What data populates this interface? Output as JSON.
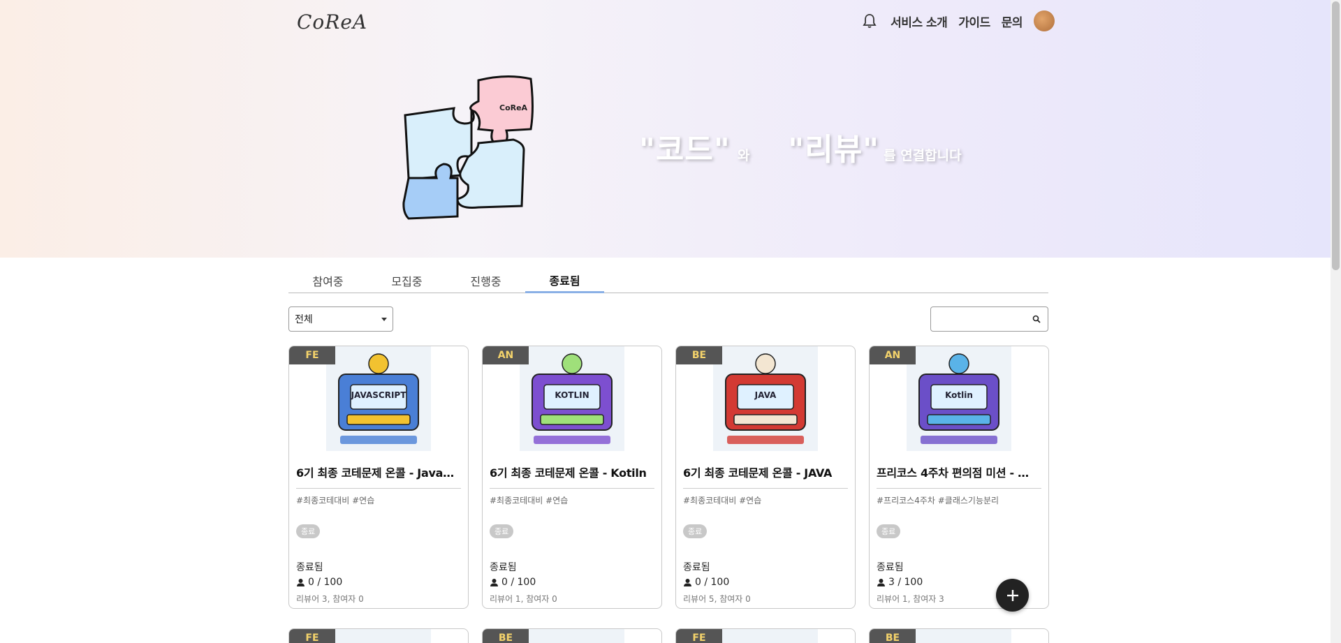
{
  "header": {
    "logo": "CoReA",
    "nav": [
      "서비스 소개",
      "가이드",
      "문의"
    ]
  },
  "hero": {
    "puzzle_label": "CoReA",
    "word1": "\"코드\"",
    "joiner1": "와",
    "word2": "\"리뷰\"",
    "joiner2": "를 연결합니다"
  },
  "tabs": [
    {
      "label": "참여중",
      "active": false
    },
    {
      "label": "모집중",
      "active": false
    },
    {
      "label": "진행중",
      "active": false
    },
    {
      "label": "종료됨",
      "active": true
    }
  ],
  "filter": {
    "selected": "전체"
  },
  "search": {
    "placeholder": ""
  },
  "cards": [
    {
      "badge": "FE",
      "title": "6기 최종 코테문제 온콜 - Java…",
      "tags": "#최종코테대비 #연습",
      "chip": "종료",
      "state": "종료됨",
      "count": "0 / 100",
      "meta": "리뷰어 3, 참여자 0",
      "thumb_text": "JAVASCRIPT",
      "thumb_colors": [
        "#4a7fd6",
        "#f2c230"
      ]
    },
    {
      "badge": "AN",
      "title": "6기 최종 코테문제 온콜 - Kotiln",
      "tags": "#최종코테대비 #연습",
      "chip": "종료",
      "state": "종료됨",
      "count": "0 / 100",
      "meta": "리뷰어 1, 참여자 0",
      "thumb_text": "KOTLIN",
      "thumb_colors": [
        "#7d4fd0",
        "#9fe07a"
      ]
    },
    {
      "badge": "BE",
      "title": "6기 최종 코테문제 온콜 - JAVA",
      "tags": "#최종코테대비 #연습",
      "chip": "종료",
      "state": "종료됨",
      "count": "0 / 100",
      "meta": "리뷰어 5, 참여자 0",
      "thumb_text": "JAVA",
      "thumb_colors": [
        "#d33a33",
        "#f3e6d2"
      ]
    },
    {
      "badge": "AN",
      "title": "프리코스 4주차 편의점 미션 - …",
      "tags": "#프리코스4주차 #클래스기능분리",
      "chip": "종료",
      "state": "종료됨",
      "count": "3 / 100",
      "meta": "리뷰어 1, 참여자 3",
      "thumb_text": "Kotlin",
      "thumb_colors": [
        "#6b4fc8",
        "#5ab3e8"
      ]
    }
  ],
  "next_row_badges": [
    "FE",
    "BE",
    "FE",
    "BE"
  ]
}
